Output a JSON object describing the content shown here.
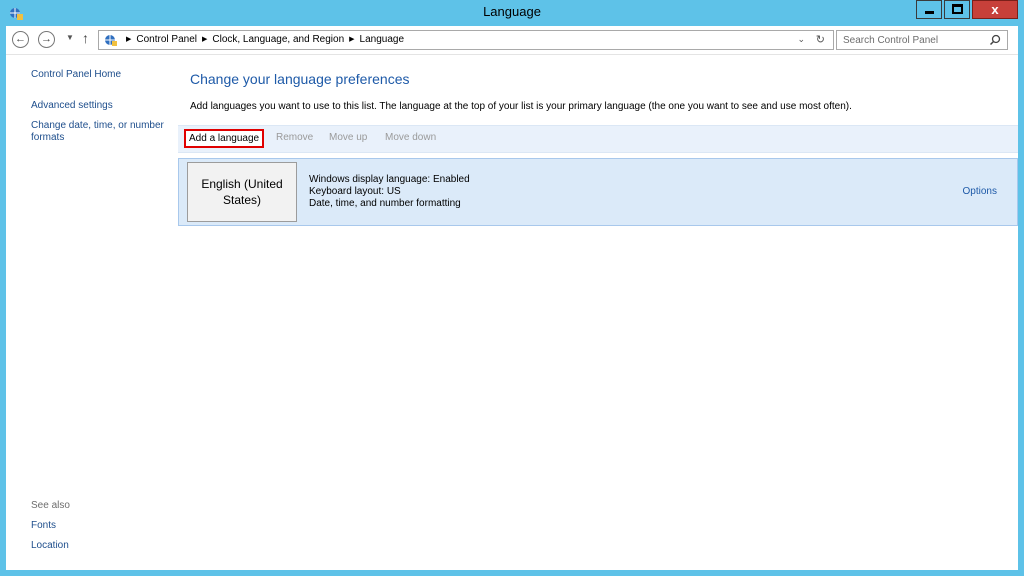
{
  "window": {
    "title": "Language",
    "controls": {
      "minimize": "minimize",
      "maximize": "maximize",
      "close_label": "x"
    }
  },
  "nav": {
    "breadcrumbs": [
      "Control Panel",
      "Clock, Language, and Region",
      "Language"
    ],
    "search_placeholder": "Search Control Panel"
  },
  "sidebar": {
    "items": [
      {
        "label": "Control Panel Home"
      },
      {
        "label": "Advanced settings"
      },
      {
        "label": "Change date, time, or number formats"
      }
    ],
    "see_also_label": "See also",
    "see_also_items": [
      {
        "label": "Fonts"
      },
      {
        "label": "Location"
      }
    ]
  },
  "main": {
    "heading": "Change your language preferences",
    "description": "Add languages you want to use to this list. The language at the top of your list is your primary language (the one you want to see and use most often).",
    "toolbar": {
      "add": "Add a language",
      "remove": "Remove",
      "move_up": "Move up",
      "move_down": "Move down"
    },
    "languages": [
      {
        "name": "English (United States)",
        "details": [
          "Windows display language: Enabled",
          "Keyboard layout: US",
          "Date, time, and number formatting"
        ],
        "options_label": "Options"
      }
    ]
  },
  "colors": {
    "titlebar": "#5ec2e8",
    "link": "#1e4e8c",
    "heading": "#1e5aa8",
    "highlight_border": "#e00000",
    "selected_row": "#dbeaf9"
  }
}
